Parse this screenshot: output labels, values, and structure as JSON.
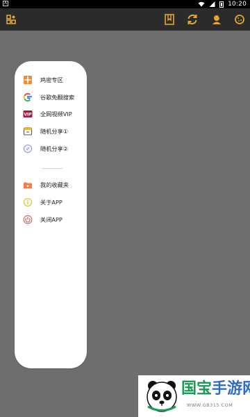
{
  "status_bar": {
    "time": "10:20",
    "left_glyph": "A"
  },
  "app_bar": {
    "icons": {
      "left": "grid-icon",
      "bookmark": "bookmark-icon",
      "refresh": "refresh-icon",
      "profile": "profile-icon",
      "cookie": "cookie-icon"
    }
  },
  "menu": {
    "items": [
      {
        "label": "鸡密专区",
        "icon": "grid-orange-icon"
      },
      {
        "label": "谷歌免翻搜索",
        "icon": "google-icon"
      },
      {
        "label": "全网视频VIP",
        "icon": "vip-icon"
      },
      {
        "label": "随机分享①",
        "icon": "share-box-icon"
      },
      {
        "label": "随机分享②",
        "icon": "compass-icon"
      },
      {
        "label": "我的收藏夹",
        "icon": "folder-star-icon"
      },
      {
        "label": "关于APP",
        "icon": "info-icon"
      },
      {
        "label": "关闭APP",
        "icon": "power-icon"
      }
    ]
  },
  "watermark": {
    "title_part1": "国宝",
    "title_part2": "手游网",
    "url": "WWW.GB315.COM"
  },
  "colors": {
    "background": "#6e6e6e",
    "app_bar": "#2b2b2b",
    "accent": "#e4a733",
    "menu_bg": "#ffffff"
  }
}
